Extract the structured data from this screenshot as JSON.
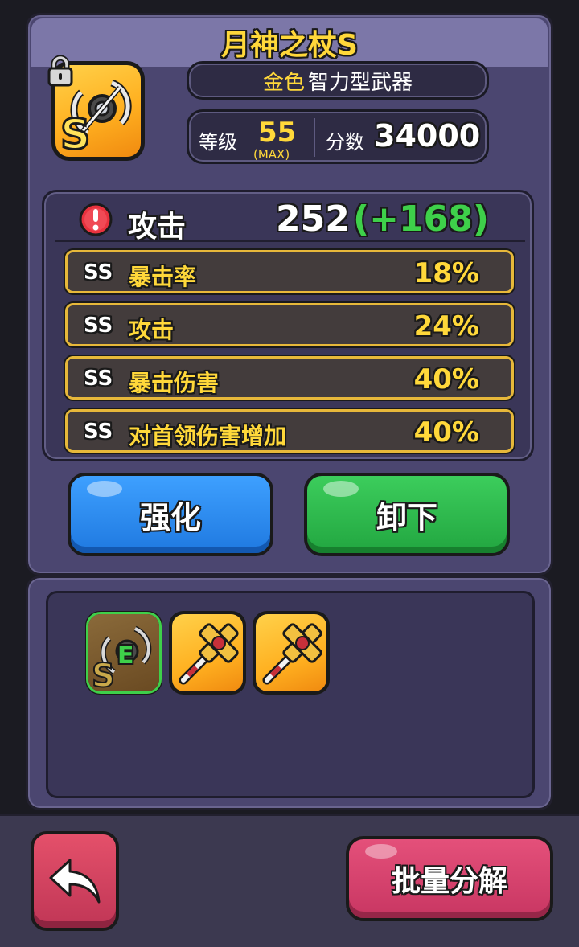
{
  "weapon": {
    "title": "月神之杖S",
    "rarity": "金色",
    "type": "智力型武器",
    "level_label": "等级",
    "level": "55",
    "level_max": "(MAX)",
    "score_label": "分数",
    "score": "34000"
  },
  "main_stat": {
    "label": "攻击",
    "value": "252",
    "bonus": "(+168)"
  },
  "sub_stats": [
    {
      "grade": "SS",
      "name": "暴击率",
      "value": "18%"
    },
    {
      "grade": "SS",
      "name": "攻击",
      "value": "24%"
    },
    {
      "grade": "SS",
      "name": "暴击伤害",
      "value": "40%"
    },
    {
      "grade": "SS",
      "name": "对首领伤害增加",
      "value": "40%"
    }
  ],
  "actions": {
    "enhance_label": "强化",
    "unequip_label": "卸下"
  },
  "inventory": {
    "equipped_badge": "E",
    "items": [
      {
        "icon": "moon-staff-icon",
        "equipped": true
      },
      {
        "icon": "cross-staff-icon",
        "equipped": false
      },
      {
        "icon": "cross-staff-icon",
        "equipped": false
      }
    ]
  },
  "bottom": {
    "back_icon": "back-arrow-icon",
    "bulk_salvage_label": "批量分解"
  },
  "colors": {
    "gold_text": "#ffd83a",
    "bonus_green": "#3ed04a",
    "blue_button": "#2b8cf0",
    "green_button": "#2cb84a",
    "pink_button": "#d4406a"
  }
}
